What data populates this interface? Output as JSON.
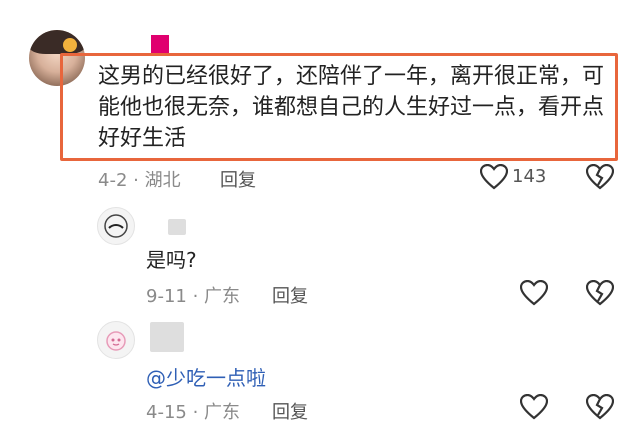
{
  "comments": [
    {
      "text": "这男的已经很好了，还陪伴了一年，离开很正常，可能他也很无奈，谁都想自己的人生好过一点，看开点好好生活",
      "date_location": "4-2 · 湖北",
      "reply_label": "回复",
      "like_count": "143"
    },
    {
      "text": "是吗?",
      "date_location": "9-11 · 广东",
      "reply_label": "回复"
    },
    {
      "mention": "@少吃一点啦",
      "date_location": "4-15 · 广东",
      "reply_label": "回复"
    }
  ],
  "colors": {
    "highlight": "#e8663c",
    "mention": "#2f5fb5",
    "pink_badge": "#e0006f"
  },
  "icons": [
    "heart-outline-icon",
    "broken-heart-icon"
  ]
}
